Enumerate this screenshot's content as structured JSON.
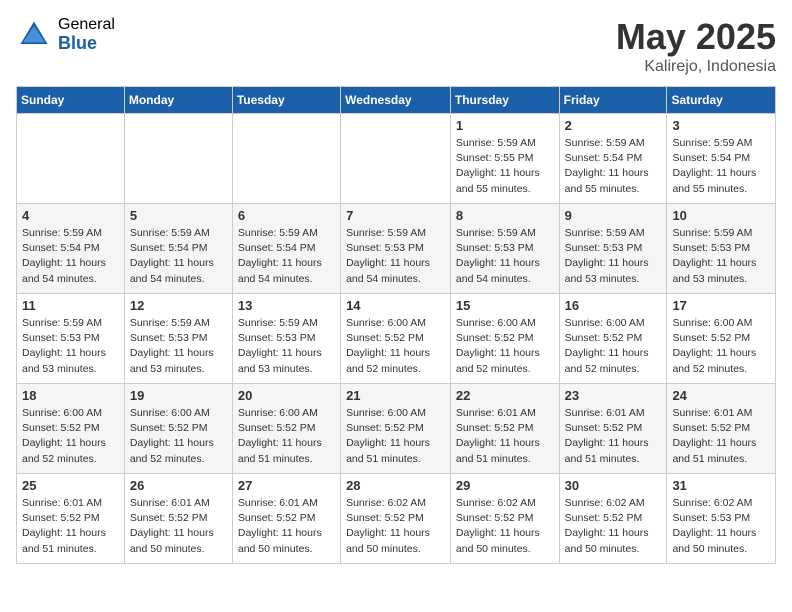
{
  "logo": {
    "general": "General",
    "blue": "Blue"
  },
  "title": {
    "month_year": "May 2025",
    "location": "Kalirejo, Indonesia"
  },
  "days_of_week": [
    "Sunday",
    "Monday",
    "Tuesday",
    "Wednesday",
    "Thursday",
    "Friday",
    "Saturday"
  ],
  "weeks": [
    [
      {
        "day": "",
        "sunrise": "",
        "sunset": "",
        "daylight": ""
      },
      {
        "day": "",
        "sunrise": "",
        "sunset": "",
        "daylight": ""
      },
      {
        "day": "",
        "sunrise": "",
        "sunset": "",
        "daylight": ""
      },
      {
        "day": "",
        "sunrise": "",
        "sunset": "",
        "daylight": ""
      },
      {
        "day": "1",
        "sunrise": "5:59 AM",
        "sunset": "5:55 PM",
        "daylight": "11 hours and 55 minutes."
      },
      {
        "day": "2",
        "sunrise": "5:59 AM",
        "sunset": "5:54 PM",
        "daylight": "11 hours and 55 minutes."
      },
      {
        "day": "3",
        "sunrise": "5:59 AM",
        "sunset": "5:54 PM",
        "daylight": "11 hours and 55 minutes."
      }
    ],
    [
      {
        "day": "4",
        "sunrise": "5:59 AM",
        "sunset": "5:54 PM",
        "daylight": "11 hours and 54 minutes."
      },
      {
        "day": "5",
        "sunrise": "5:59 AM",
        "sunset": "5:54 PM",
        "daylight": "11 hours and 54 minutes."
      },
      {
        "day": "6",
        "sunrise": "5:59 AM",
        "sunset": "5:54 PM",
        "daylight": "11 hours and 54 minutes."
      },
      {
        "day": "7",
        "sunrise": "5:59 AM",
        "sunset": "5:53 PM",
        "daylight": "11 hours and 54 minutes."
      },
      {
        "day": "8",
        "sunrise": "5:59 AM",
        "sunset": "5:53 PM",
        "daylight": "11 hours and 54 minutes."
      },
      {
        "day": "9",
        "sunrise": "5:59 AM",
        "sunset": "5:53 PM",
        "daylight": "11 hours and 53 minutes."
      },
      {
        "day": "10",
        "sunrise": "5:59 AM",
        "sunset": "5:53 PM",
        "daylight": "11 hours and 53 minutes."
      }
    ],
    [
      {
        "day": "11",
        "sunrise": "5:59 AM",
        "sunset": "5:53 PM",
        "daylight": "11 hours and 53 minutes."
      },
      {
        "day": "12",
        "sunrise": "5:59 AM",
        "sunset": "5:53 PM",
        "daylight": "11 hours and 53 minutes."
      },
      {
        "day": "13",
        "sunrise": "5:59 AM",
        "sunset": "5:53 PM",
        "daylight": "11 hours and 53 minutes."
      },
      {
        "day": "14",
        "sunrise": "6:00 AM",
        "sunset": "5:52 PM",
        "daylight": "11 hours and 52 minutes."
      },
      {
        "day": "15",
        "sunrise": "6:00 AM",
        "sunset": "5:52 PM",
        "daylight": "11 hours and 52 minutes."
      },
      {
        "day": "16",
        "sunrise": "6:00 AM",
        "sunset": "5:52 PM",
        "daylight": "11 hours and 52 minutes."
      },
      {
        "day": "17",
        "sunrise": "6:00 AM",
        "sunset": "5:52 PM",
        "daylight": "11 hours and 52 minutes."
      }
    ],
    [
      {
        "day": "18",
        "sunrise": "6:00 AM",
        "sunset": "5:52 PM",
        "daylight": "11 hours and 52 minutes."
      },
      {
        "day": "19",
        "sunrise": "6:00 AM",
        "sunset": "5:52 PM",
        "daylight": "11 hours and 52 minutes."
      },
      {
        "day": "20",
        "sunrise": "6:00 AM",
        "sunset": "5:52 PM",
        "daylight": "11 hours and 51 minutes."
      },
      {
        "day": "21",
        "sunrise": "6:00 AM",
        "sunset": "5:52 PM",
        "daylight": "11 hours and 51 minutes."
      },
      {
        "day": "22",
        "sunrise": "6:01 AM",
        "sunset": "5:52 PM",
        "daylight": "11 hours and 51 minutes."
      },
      {
        "day": "23",
        "sunrise": "6:01 AM",
        "sunset": "5:52 PM",
        "daylight": "11 hours and 51 minutes."
      },
      {
        "day": "24",
        "sunrise": "6:01 AM",
        "sunset": "5:52 PM",
        "daylight": "11 hours and 51 minutes."
      }
    ],
    [
      {
        "day": "25",
        "sunrise": "6:01 AM",
        "sunset": "5:52 PM",
        "daylight": "11 hours and 51 minutes."
      },
      {
        "day": "26",
        "sunrise": "6:01 AM",
        "sunset": "5:52 PM",
        "daylight": "11 hours and 50 minutes."
      },
      {
        "day": "27",
        "sunrise": "6:01 AM",
        "sunset": "5:52 PM",
        "daylight": "11 hours and 50 minutes."
      },
      {
        "day": "28",
        "sunrise": "6:02 AM",
        "sunset": "5:52 PM",
        "daylight": "11 hours and 50 minutes."
      },
      {
        "day": "29",
        "sunrise": "6:02 AM",
        "sunset": "5:52 PM",
        "daylight": "11 hours and 50 minutes."
      },
      {
        "day": "30",
        "sunrise": "6:02 AM",
        "sunset": "5:52 PM",
        "daylight": "11 hours and 50 minutes."
      },
      {
        "day": "31",
        "sunrise": "6:02 AM",
        "sunset": "5:53 PM",
        "daylight": "11 hours and 50 minutes."
      }
    ]
  ]
}
